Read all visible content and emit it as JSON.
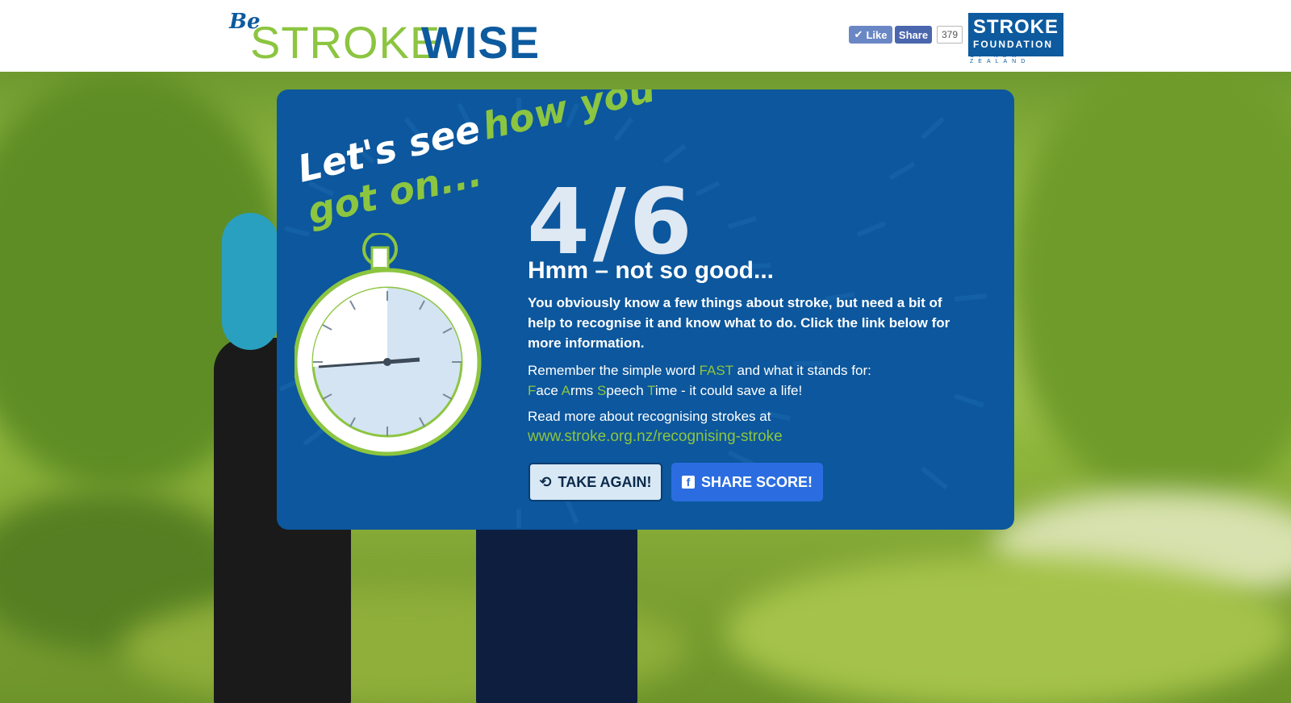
{
  "header": {
    "logo_be": "Be",
    "logo_stroke": "STROKE",
    "logo_wise": "WISE",
    "fb_like_label": "Like",
    "fb_share_label": "Share",
    "fb_count": "379",
    "partner_logo_line1": "STROKE",
    "partner_logo_line2": "FOUNDATION",
    "partner_logo_line3": "OF NEW ZEALAND"
  },
  "result": {
    "headline_part1": "Let's see",
    "headline_part2": "how you got on...",
    "score": "4/6",
    "verdict": "Hmm – not so good...",
    "description": "You obviously know a few things about stroke, but need a bit of help to recognise it and know what to do. Click the link below for more information.",
    "fast_intro": "Remember the simple word",
    "fast_word": "FAST",
    "fast_intro_end": "and what it stands for:",
    "fast_f": "F",
    "fast_face": "ace",
    "fast_a": "A",
    "fast_arms": "rms",
    "fast_s": "S",
    "fast_speech": "peech",
    "fast_t": "T",
    "fast_time": "ime - it could save a life!",
    "read_more": "Read more about recognising strokes at",
    "link_text": "www.stroke.org.nz/recognising-stroke"
  },
  "buttons": {
    "take_again": "TAKE AGAIN!",
    "share_score": "SHARE SCORE!"
  },
  "colors": {
    "brand_blue": "#0c579d",
    "brand_green": "#8cc540",
    "share_button": "#2b6de0",
    "take_again_button": "#d8e8f5"
  },
  "icons": {
    "take_again": "refresh-icon",
    "share_score": "facebook-icon",
    "fb_like": "thumbs-up-icon"
  }
}
